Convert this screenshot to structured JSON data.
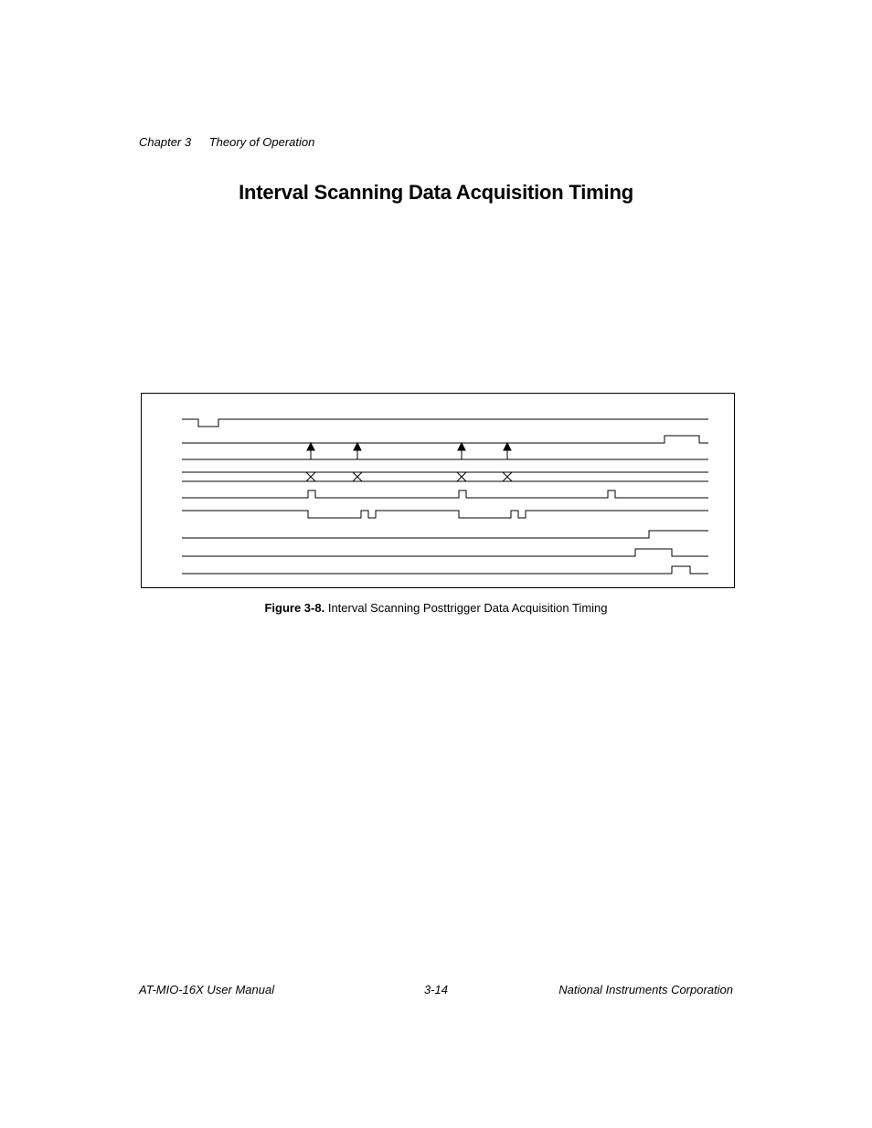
{
  "header": {
    "chapter": "Chapter 3",
    "section": "Theory of Operation"
  },
  "title": "Interval Scanning Data Acquisition Timing",
  "figure": {
    "label": "Figure 3-8.",
    "caption": "Interval Scanning Posttrigger Data Acquisition Timing"
  },
  "footer": {
    "left": "AT-MIO-16X User Manual",
    "center": "3-14",
    "right": "National Instruments Corporation"
  }
}
